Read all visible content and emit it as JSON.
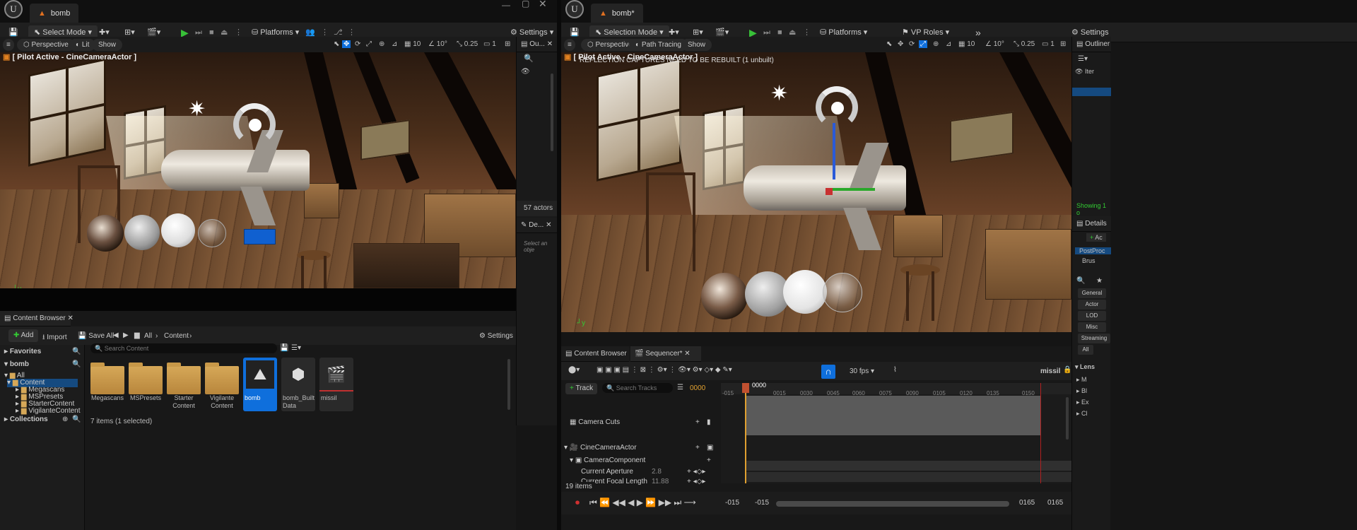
{
  "left": {
    "tab_title": "bomb",
    "toolbar": {
      "mode": "Select Mode",
      "platforms": "Platforms",
      "settings": "Settings"
    },
    "viewport": {
      "perspective": "Perspective",
      "lit": "Lit",
      "show": "Show",
      "grid": "10",
      "angle": "10°",
      "scale": "0.25",
      "cam": "1",
      "label": "[ Pilot Active - CineCameraActor ]"
    },
    "outliner": {
      "tab": "Ou...",
      "count": "57 actors"
    },
    "details": {
      "tab": "De...",
      "hint": "Select an obje"
    },
    "content_browser": {
      "tab": "Content Browser",
      "add": "Add",
      "import": "Import",
      "save_all": "Save All",
      "crumb_all": "All",
      "crumb_content": "Content",
      "settings": "Settings",
      "favorites": "Favorites",
      "project": "bomb",
      "search_placeholder": "Search Content",
      "tree": [
        "All",
        "Content",
        "Megascans",
        "MSPresets",
        "StarterContent",
        "VigilanteContent"
      ],
      "assets": [
        "Megascans",
        "MSPresets",
        "Starter Content",
        "Vigilante Content",
        "bomb",
        "bomb_Built Data",
        "missil"
      ],
      "collections": "Collections",
      "status": "7 items (1 selected)"
    }
  },
  "right": {
    "tab_title": "bomb*",
    "toolbar": {
      "mode": "Selection Mode",
      "platforms": "Platforms",
      "vp_roles": "VP Roles",
      "settings": "Settings"
    },
    "viewport": {
      "perspective": "Perspective",
      "path_tracing": "Path Tracing",
      "show": "Show",
      "grid": "10",
      "angle": "10°",
      "scale": "0.25",
      "cam": "1",
      "label": "[ Pilot Active - CineCameraActor ]",
      "warning": "REFLECTION CAPTURES NEED TO BE REBUILT (1 unbuilt)"
    },
    "outliner": {
      "tab": "Outliner",
      "col_item": "Iter",
      "showing": "Showing 1 o"
    },
    "details": {
      "tab": "Details",
      "add": "Ac",
      "item1": "PostProc",
      "item2": "Brus",
      "cats": [
        "General",
        "Actor",
        "LOD",
        "Misc",
        "Streaming",
        "All"
      ],
      "lens": "Lens",
      "lens_rows": [
        "M",
        "Bl",
        "Ex",
        "Cl"
      ]
    },
    "sequencer": {
      "tab_cb": "Content Browser",
      "tab_seq": "Sequencer*",
      "fps": "30 fps",
      "seq_name": "missil",
      "track_btn": "Track",
      "search_placeholder": "Search Tracks",
      "frame": "0000",
      "playhead": "0000",
      "ticks": [
        "-015",
        "0015",
        "0030",
        "0045",
        "0060",
        "0075",
        "0090",
        "0105",
        "0120",
        "0135",
        "0150"
      ],
      "tracks": [
        "Camera Cuts",
        "CineCameraActor",
        "CameraComponent",
        "Current Aperture",
        "Current Focal Length"
      ],
      "aperture": "2.8",
      "focal": "11.88",
      "items": "19 items",
      "range_start_a": "-015",
      "range_start_b": "-015",
      "range_end_a": "0165",
      "range_end_b": "0165"
    }
  }
}
